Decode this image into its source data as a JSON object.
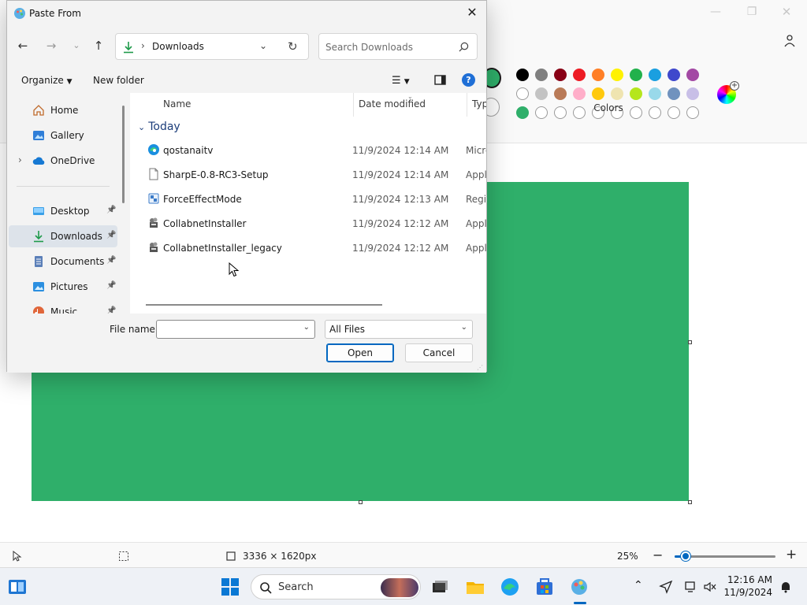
{
  "paint": {
    "colors_label": "Colors",
    "palette_row1": [
      "#000000",
      "#7f7f7f",
      "#880015",
      "#ed1c24",
      "#ff7f27",
      "#fff200",
      "#22b14c",
      "#1a9fe0",
      "#3f48cc",
      "#a349a4"
    ],
    "palette_row2": [
      "#ffffff",
      "#c3c3c3",
      "#b97a57",
      "#ffaec9",
      "#ffc90e",
      "#efe4b0",
      "#b5e61d",
      "#99d9ea",
      "#7092be",
      "#c8bfe7"
    ],
    "palette_row3": [
      "#2faf6a"
    ],
    "selected_color": "#2faf6a",
    "canvas_color": "#2faf6a",
    "canvas_size": "3336 × 1620px",
    "zoom": "25%",
    "zoom_level": 0.11
  },
  "dialog": {
    "title": "Paste From",
    "address": "Downloads",
    "search_placeholder": "Search Downloads",
    "organize_label": "Organize",
    "new_folder_label": "New folder",
    "nav_items": [
      {
        "label": "Home",
        "icon": "home-icon"
      },
      {
        "label": "Gallery",
        "icon": "gallery-icon"
      },
      {
        "label": "OneDrive",
        "icon": "cloud-icon"
      },
      {
        "label": "Desktop",
        "icon": "desktop-icon"
      },
      {
        "label": "Downloads",
        "icon": "download-icon"
      },
      {
        "label": "Documents",
        "icon": "document-icon"
      },
      {
        "label": "Pictures",
        "icon": "pictures-icon"
      },
      {
        "label": "Music",
        "icon": "music-icon"
      }
    ],
    "columns": {
      "name": "Name",
      "date": "Date modified",
      "type": "Type"
    },
    "group": "Today",
    "files": [
      {
        "name": "qostanaitv",
        "date": "11/9/2024 12:14 AM",
        "type": "Micro",
        "icon": "edge-icon"
      },
      {
        "name": "SharpE-0.8-RC3-Setup",
        "date": "11/9/2024 12:14 AM",
        "type": "Appli",
        "icon": "file-icon"
      },
      {
        "name": "ForceEffectMode",
        "date": "11/9/2024 12:13 AM",
        "type": "Regis",
        "icon": "registry-icon"
      },
      {
        "name": "CollabnetInstaller",
        "date": "11/9/2024 12:12 AM",
        "type": "Appli",
        "icon": "installer-icon"
      },
      {
        "name": "CollabnetInstaller_legacy",
        "date": "11/9/2024 12:12 AM",
        "type": "Appli",
        "icon": "installer-icon"
      }
    ],
    "file_name_label": "File name:",
    "file_name_value": "",
    "file_type": "All Files",
    "open_label": "Open",
    "cancel_label": "Cancel"
  },
  "taskbar": {
    "search_label": "Search",
    "time": "12:16 AM",
    "date": "11/9/2024"
  }
}
